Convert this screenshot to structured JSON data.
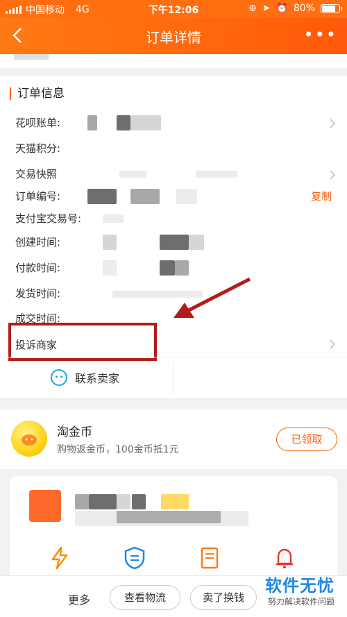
{
  "status_bar": {
    "carrier": "中国移动",
    "network": "4G",
    "time": "下午12:06",
    "battery": "80%",
    "battery_level": 0.8
  },
  "nav": {
    "title": "订单详情"
  },
  "order_info": {
    "section_title": "订单信息",
    "rows": [
      {
        "label": "花呗账单:"
      },
      {
        "label": "天猫积分:"
      },
      {
        "label": "交易快照"
      },
      {
        "label": "订单编号:"
      },
      {
        "label": "支付宝交易号:"
      },
      {
        "label": "创建时间:"
      },
      {
        "label": "付款时间:"
      },
      {
        "label": "发货时间:"
      },
      {
        "label": "成交时间:"
      }
    ],
    "copy_label": "复制",
    "complain_label": "投诉商家",
    "contact_label": "联系卖家"
  },
  "coin": {
    "title": "淘金币",
    "desc": "购物返金币，100金币抵1元",
    "button": "已领取"
  },
  "bottom": {
    "more": "更多",
    "logistics": "查看物流",
    "resell": "卖了换钱"
  },
  "watermark": {
    "main": "软件无忧",
    "sub": "努力解决软件问题"
  },
  "colors": {
    "accent": "#ff5a0a",
    "highlight_box": "#b11d1d",
    "watermark": "#1e88e5"
  }
}
